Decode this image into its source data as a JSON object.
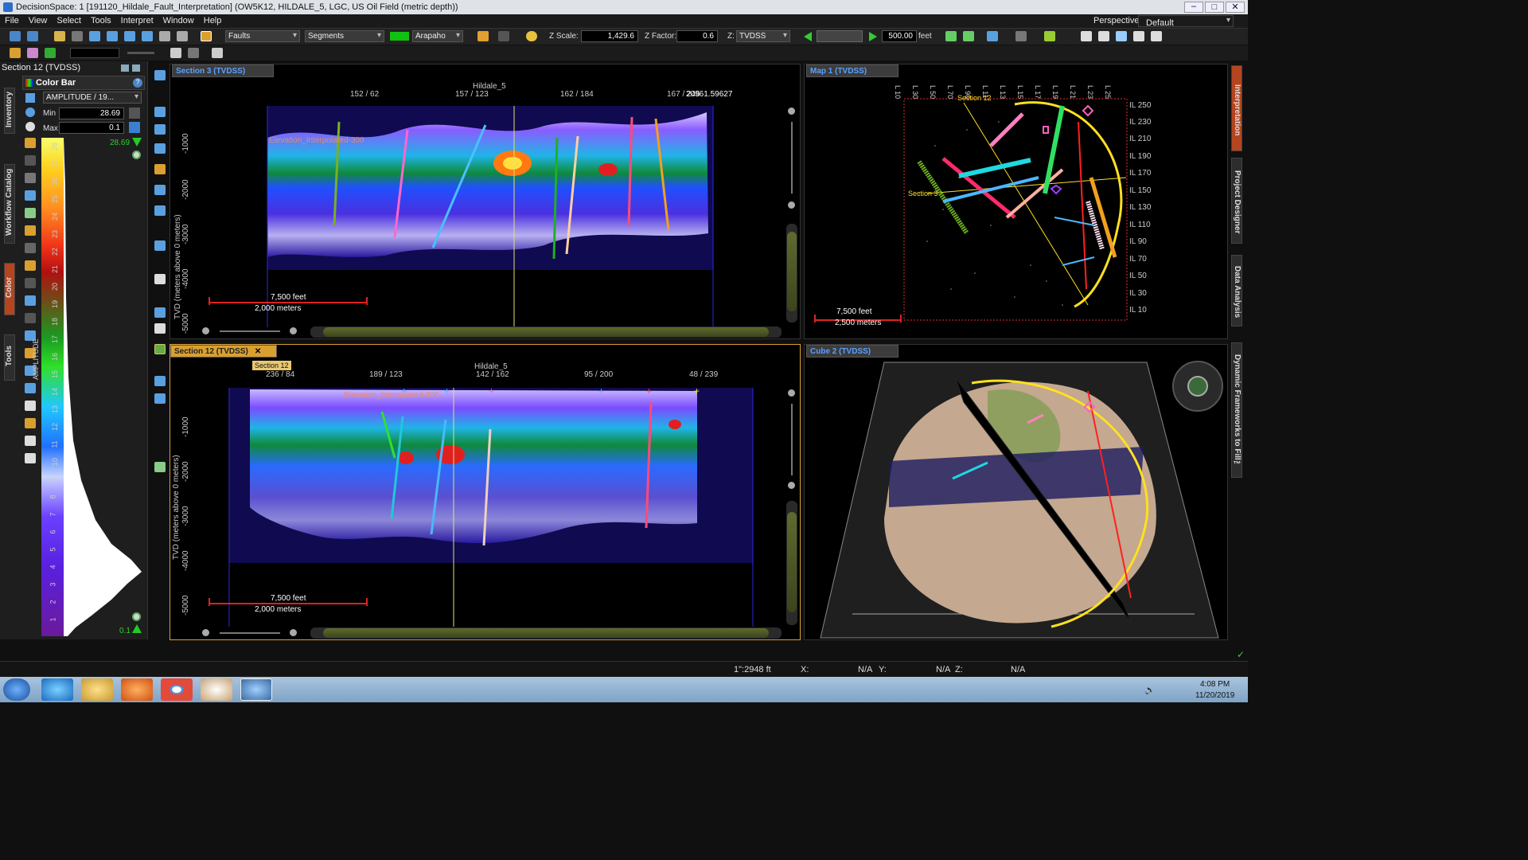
{
  "window": {
    "title": "DecisionSpace: 1 [191120_Hildale_Fault_Interpretation] (OW5K12, HILDALE_5, LGC, US Oil Field (metric depth))"
  },
  "menu": [
    "File",
    "View",
    "Select",
    "Tools",
    "Interpret",
    "Window",
    "Help"
  ],
  "perspective": {
    "label": "Perspective:",
    "value": "Default"
  },
  "toolbar": {
    "faults": "Faults",
    "segments": "Segments",
    "color_name": "Arapaho",
    "z_scale_label": "Z Scale:",
    "z_scale_value": "1,429.6",
    "z_factor_label": "Z Factor:",
    "z_factor_value": "0.6",
    "z_mode": "TVDSS",
    "speed_value": "500.00",
    "speed_unit": "feet"
  },
  "left_panel": {
    "title": "Section 12 (TVDSS)",
    "colorbar_title": "Color Bar",
    "attribute": "AMPLITUDE / 19...",
    "min_label": "Min",
    "min_value": "28.69",
    "max_label": "Max",
    "max_value": "0.1",
    "top_value": "28.69",
    "bottom_value": "0.1",
    "axis_label": "AMPLITUDE",
    "ticks": [
      "28",
      "27",
      "26",
      "25",
      "24",
      "23",
      "22",
      "21",
      "20",
      "19",
      "18",
      "17",
      "16",
      "15",
      "14",
      "13",
      "12",
      "11",
      "10",
      "9",
      "8",
      "7",
      "6",
      "5",
      "4",
      "3",
      "2",
      "1"
    ]
  },
  "left_tabs": [
    "Inventory",
    "Workflow Catalog",
    "Color",
    "Tools"
  ],
  "right_tabs": [
    "Interpretation",
    "Project Designer",
    "Data Analysis",
    "Dynamic Frameworks to Fill™"
  ],
  "section3": {
    "tab": "Section 3 (TVDSS)",
    "well": "Hildale_5",
    "top_ticks": [
      "152 / 62",
      "157 / 123",
      "162 / 184",
      "167 / 245"
    ],
    "readout": "20961.59627",
    "y_ticks": [
      "-1000",
      "-2000",
      "-3000",
      "-4000",
      "-5000"
    ],
    "y_label": "TVD (meters above 0 meters)",
    "horizon": "Elevation_Interpolated-300",
    "scale_feet": "7,500 feet",
    "scale_m": "2,000 meters"
  },
  "section12": {
    "tab": "Section 12 (TVDSS)",
    "tooltip": "Section 12",
    "well": "Hildale_5",
    "top_ticks": [
      "236 / 84",
      "189 / 123",
      "142 / 162",
      "95 / 200",
      "48 / 239"
    ],
    "y_ticks": [
      "-1000",
      "-2000",
      "-3000",
      "-4000",
      "-5000"
    ],
    "y_label": "TVD (meters above 0 meters)",
    "horizon": "Elevation_Interpolated-300",
    "scale_feet": "7,500 feet",
    "scale_m": "2,000 meters"
  },
  "map1": {
    "tab": "Map 1 (TVDSS)",
    "top_ticks": [
      "L 10",
      "L 30",
      "L 50",
      "L 70",
      "L 90",
      "L 110",
      "L 130",
      "L 150",
      "L 170",
      "L 190",
      "L 210",
      "L 230",
      "L 250"
    ],
    "right_ticks": [
      "IL 250",
      "IL 230",
      "IL 210",
      "IL 190",
      "IL 170",
      "IL 150",
      "IL 130",
      "IL 110",
      "IL 90",
      "IL 70",
      "IL 50",
      "IL 30",
      "IL 10"
    ],
    "label_s12": "Section 12",
    "label_s3": "Section 3",
    "scale_feet": "7,500 feet",
    "scale_m": "2,500 meters"
  },
  "cube2": {
    "tab": "Cube 2 (TVDSS)"
  },
  "status": {
    "scale": "1\":2948 ft",
    "x_label": "X:",
    "x_value": "N/A",
    "y_label": "Y:",
    "y_value": "N/A",
    "z_label": "Z:",
    "z_value": "N/A"
  },
  "clock": {
    "time": "4:08 PM",
    "date": "11/20/2019"
  }
}
